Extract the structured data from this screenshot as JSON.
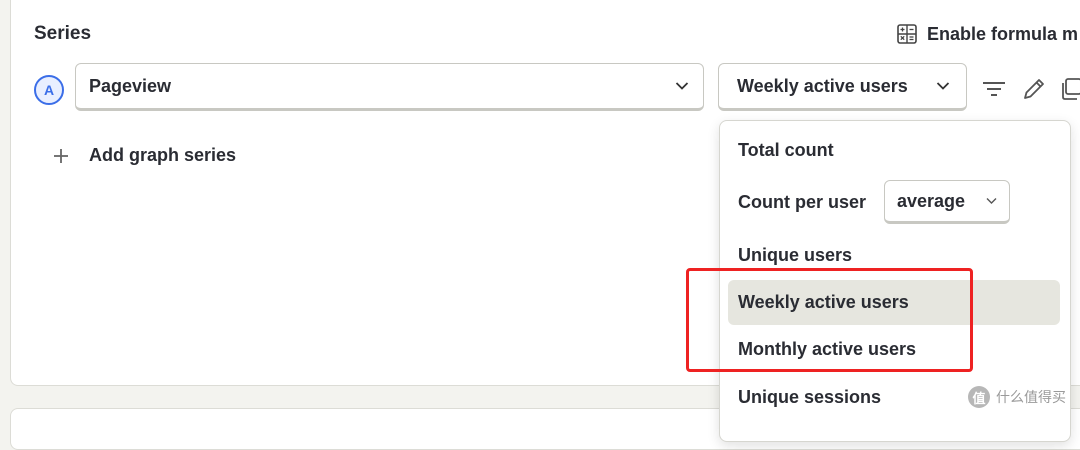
{
  "section": {
    "title": "Series",
    "formula_label": "Enable formula m"
  },
  "series": [
    {
      "badge": "A",
      "event": "Pageview",
      "math": "Weekly active users"
    }
  ],
  "add_series_label": "Add graph series",
  "dropdown": {
    "options": [
      {
        "label": "Total count"
      },
      {
        "label": "Count per user",
        "sub_value": "average"
      },
      {
        "label": "Unique users"
      },
      {
        "label": "Weekly active users",
        "selected": true
      },
      {
        "label": "Monthly active users"
      },
      {
        "label": "Unique sessions"
      }
    ]
  },
  "watermark": {
    "logo": "值",
    "text": "什么值得买"
  },
  "colors": {
    "accent": "#3b6ee8",
    "highlight": "#ee2222",
    "selected_bg": "#e6e6df"
  },
  "icons": [
    "calculator-icon",
    "chevron-down-icon",
    "filter-icon",
    "pencil-icon",
    "copy-icon",
    "plus-icon"
  ]
}
